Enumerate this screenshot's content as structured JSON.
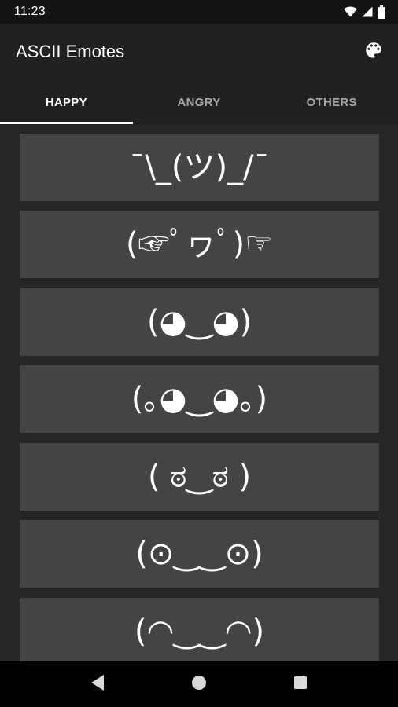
{
  "status_bar": {
    "time": "11:23",
    "icons": [
      "wifi-icon",
      "signal-icon",
      "battery-icon"
    ]
  },
  "app_bar": {
    "title": "ASCII Emotes",
    "action_icon": "palette-icon"
  },
  "tabs": [
    {
      "label": "HAPPY",
      "active": true
    },
    {
      "label": "ANGRY",
      "active": false
    },
    {
      "label": "OTHERS",
      "active": false
    }
  ],
  "emotes": [
    "¯\\_(ツ)_/¯",
    "(☞ﾟヮﾟ)☞",
    "(◕‿◕)",
    "(｡◕‿◕｡)",
    "( ಠ‿ಠ )",
    "(⊙‿‿⊙)",
    "(◠‿‿◠)"
  ],
  "nav_bar": {
    "icons": [
      "back-icon",
      "home-icon",
      "recents-icon"
    ]
  },
  "colors": {
    "status_bar": "#141414",
    "app_bar": "#212121",
    "background": "#262626",
    "card": "#444444",
    "text": "#ffffff",
    "tab_inactive": "#a7a7a7"
  }
}
